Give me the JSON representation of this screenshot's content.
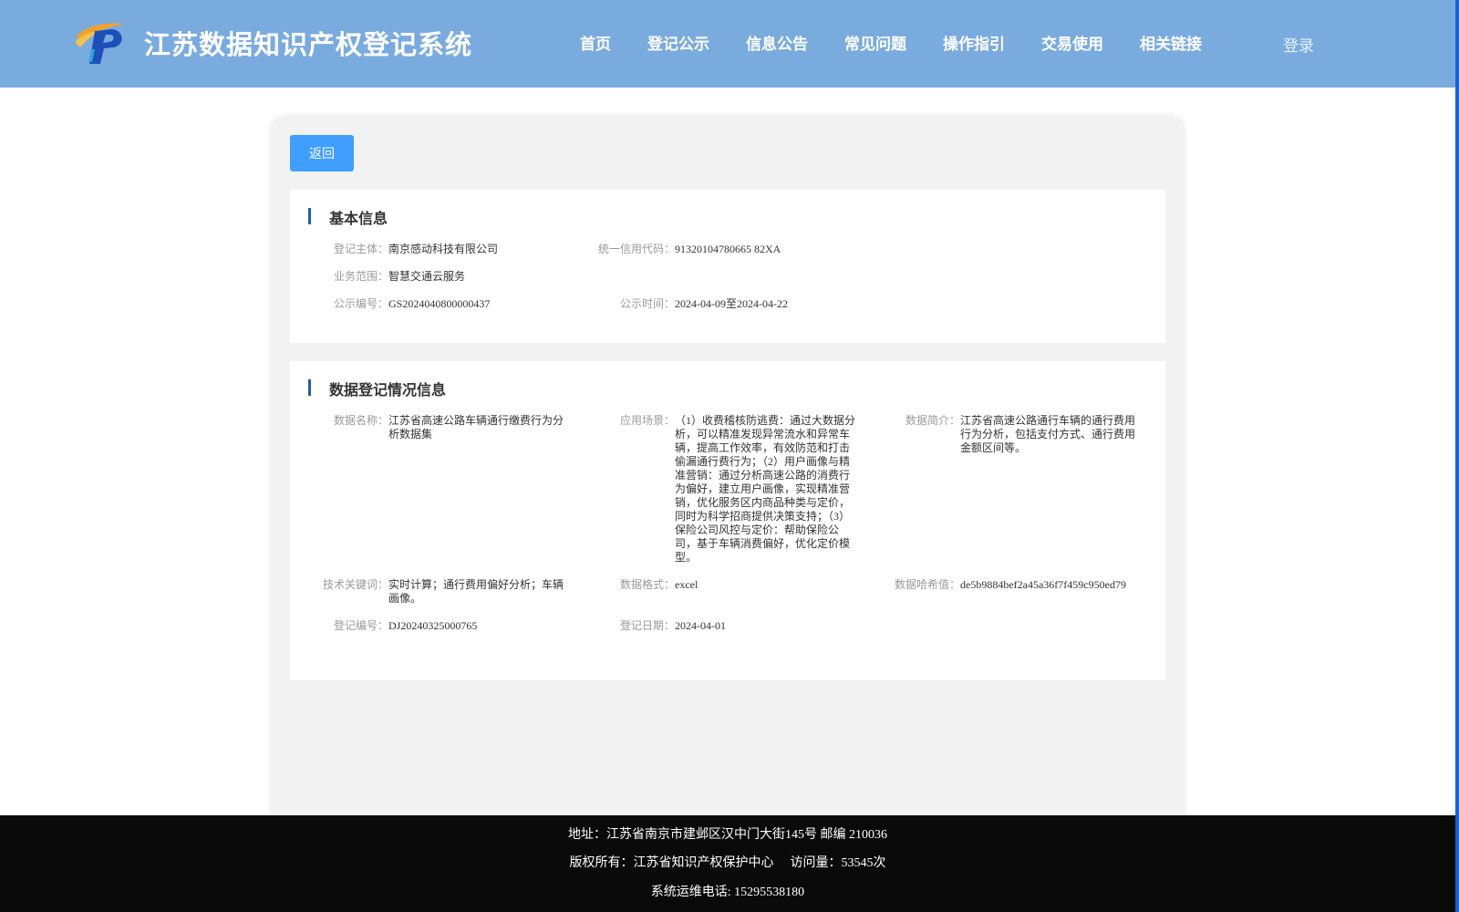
{
  "header": {
    "site_title": "江苏数据知识产权登记系统",
    "nav": [
      "首页",
      "登记公示",
      "信息公告",
      "常见问题",
      "操作指引",
      "交易使用",
      "相关链接"
    ],
    "login_label": "登录"
  },
  "actions": {
    "back_label": "返回"
  },
  "basic_info": {
    "title": "基本信息",
    "subject_label": "登记主体：",
    "subject_value": "南京感动科技有限公司",
    "credit_code_label": "统一信用代码：",
    "credit_code_value": "91320104780665 82XA",
    "scope_label": "业务范围：",
    "scope_value": "智慧交通云服务",
    "notice_no_label": "公示编号：",
    "notice_no_value": "GS2024040800000437",
    "notice_time_label": "公示时间：",
    "notice_time_value": "2024-04-09至2024-04-22"
  },
  "registration_info": {
    "title": "数据登记情况信息",
    "data_name_label": "数据名称：",
    "data_name_value": "江苏省高速公路车辆通行缴费行为分析数据集",
    "scenario_label": "应用场景：",
    "scenario_value": "（1）收费稽核防逃费：通过大数据分析，可以精准发现异常流水和异常车辆，提高工作效率，有效防范和打击偷漏通行费行为；（2）用户画像与精准营销：通过分析高速公路的消费行为偏好，建立用户画像，实现精准营销，优化服务区内商品种类与定价，同时为科学招商提供决策支持；（3）保险公司风控与定价：帮助保险公司，基于车辆消费偏好，优化定价模型。",
    "summary_label": "数据简介：",
    "summary_value": "江苏省高速公路通行车辆的通行费用行为分析，包括支付方式、通行费用金额区间等。",
    "keywords_label": "技术关键词：",
    "keywords_value": "实时计算；通行费用偏好分析；车辆画像。",
    "format_label": "数据格式：",
    "format_value": "excel",
    "hash_label": "数据哈希值：",
    "hash_value": "de5b9884bef2a45a36f7f459c950ed79",
    "reg_no_label": "登记编号：",
    "reg_no_value": "DJ20240325000765",
    "reg_date_label": "登记日期：",
    "reg_date_value": "2024-04-01"
  },
  "footer": {
    "address": "地址：江苏省南京市建邺区汉中门大街145号 邮编 210036",
    "copyright": "版权所有：江苏省知识产权保护中心",
    "visits": "访问量：53545次",
    "hotline": "系统运维电话: 15295538180"
  },
  "colors": {
    "header_bg": "#7aabdf",
    "button": "#409eff",
    "section_accent": "#1f5fa8",
    "footer_bg": "#0a0a0a"
  },
  "icons": {
    "logo": "p-logo-icon"
  }
}
